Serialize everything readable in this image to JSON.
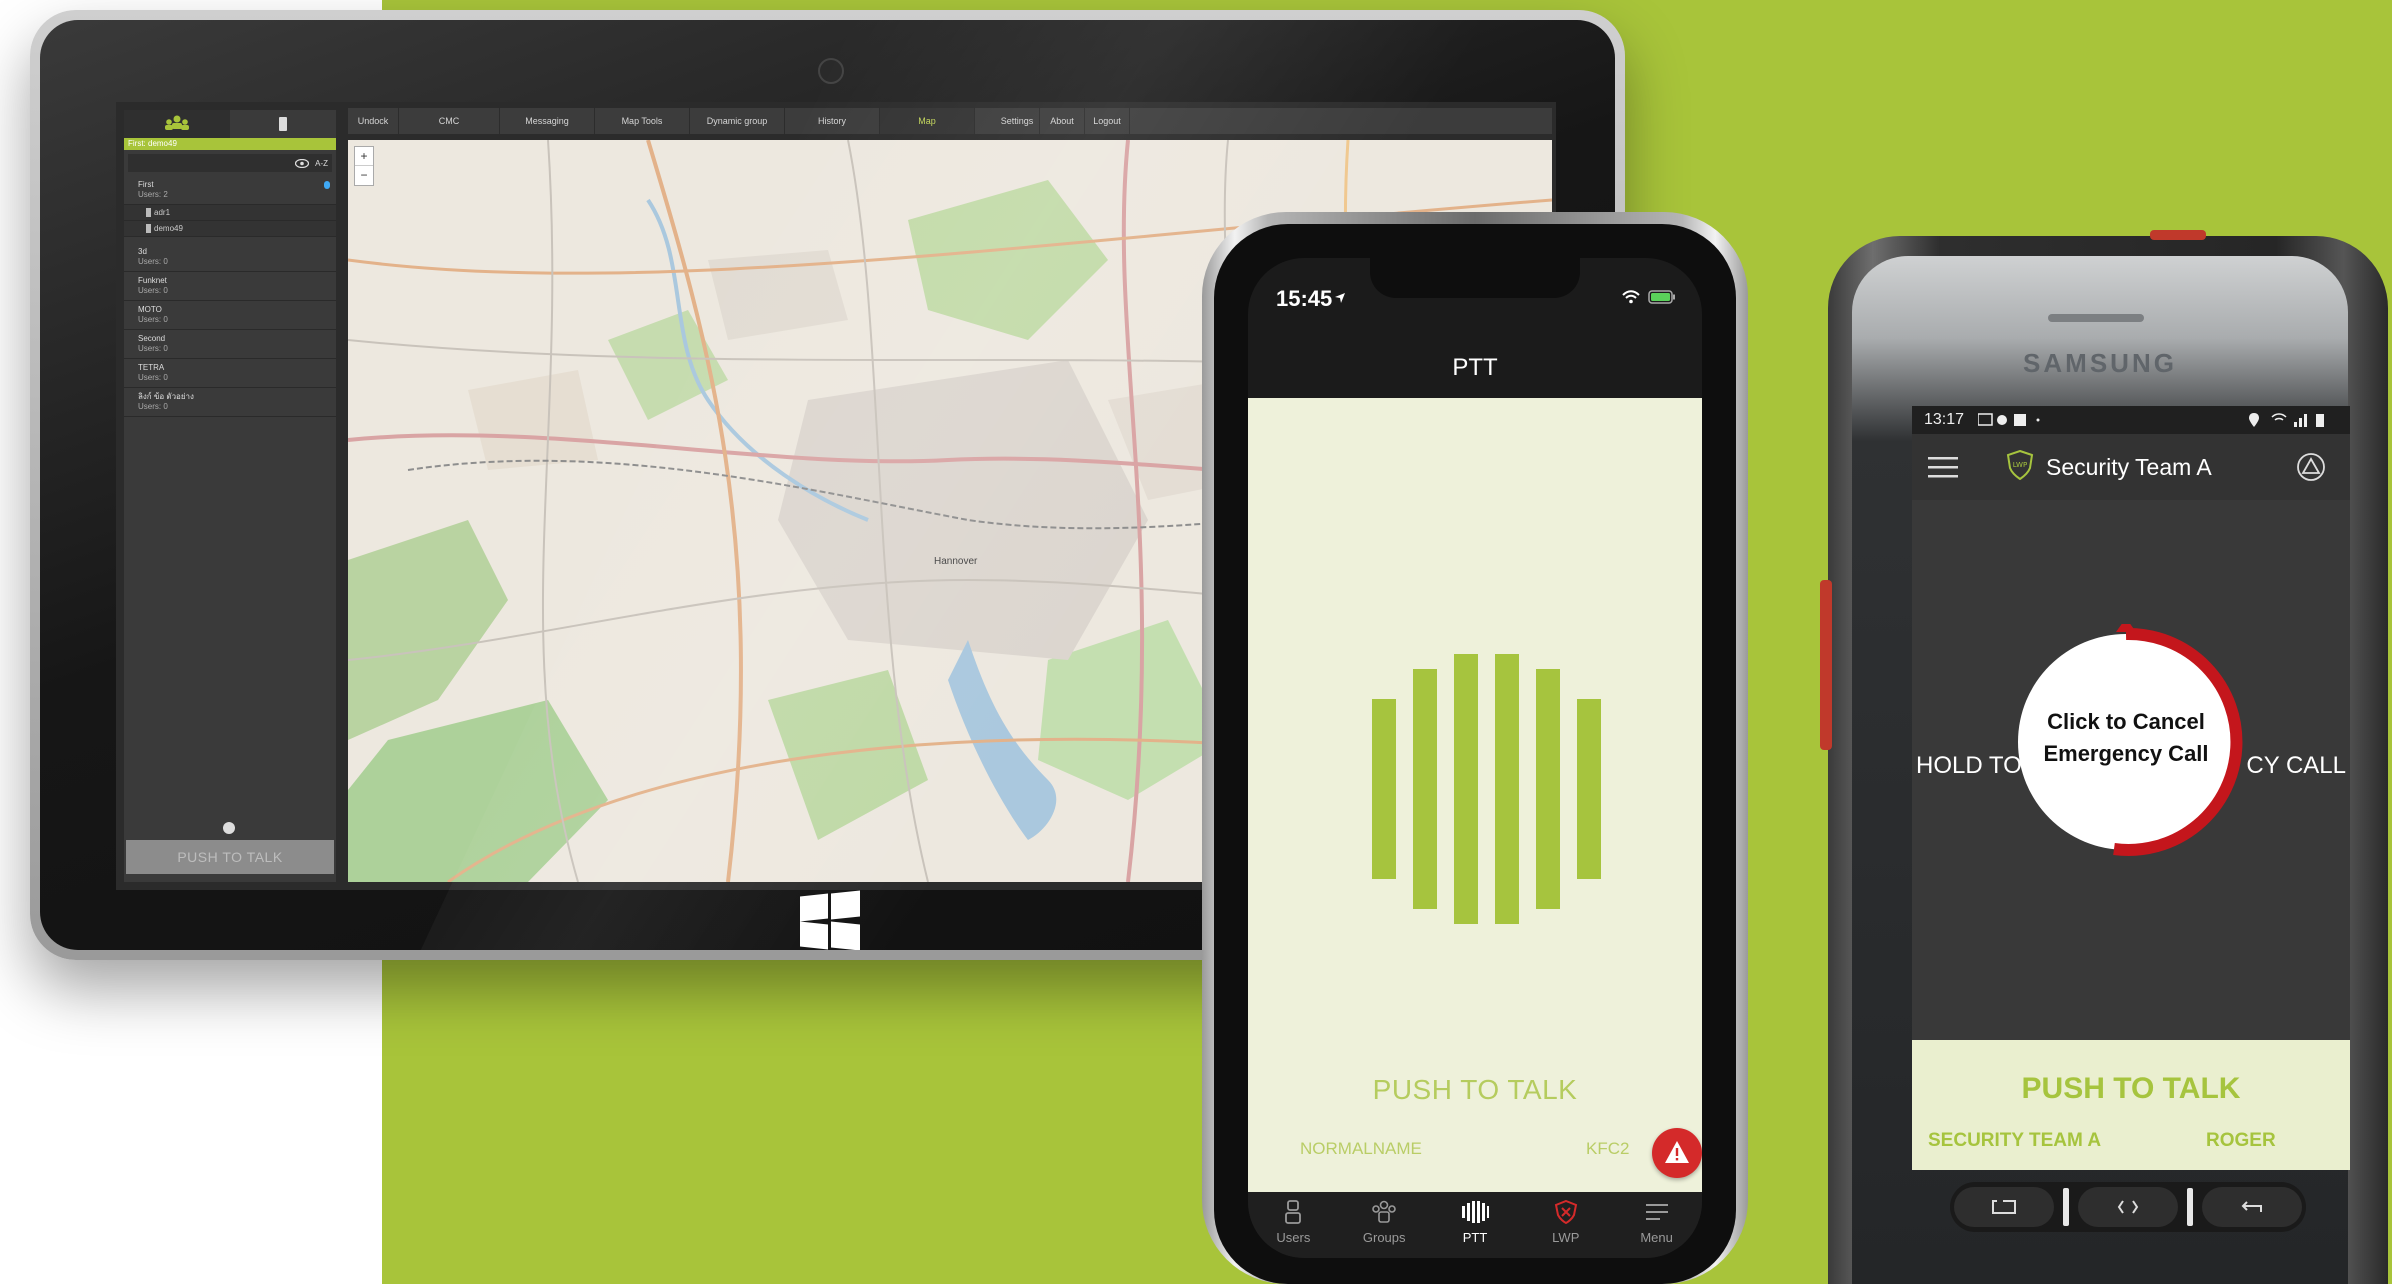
{
  "colors": {
    "background_green": "#a8c43a",
    "accent_green": "#a6c43e",
    "emergency_red": "#d42a2a",
    "panel_dark": "#3a3a3a"
  },
  "desktop": {
    "sidebar": {
      "first_bar": "First: demo49",
      "sort_label": "A-Z",
      "groups": [
        {
          "name": "First",
          "users": "Users: 2"
        },
        {
          "name": "3d",
          "users": "Users: 0"
        },
        {
          "name": "Funknet",
          "users": "Users: 0"
        },
        {
          "name": "MOTO",
          "users": "Users: 0"
        },
        {
          "name": "Second",
          "users": "Users: 0"
        },
        {
          "name": "TETRA",
          "users": "Users: 0"
        },
        {
          "name": "ลิงก์ ข้อ ตัวอย่าง",
          "users": "Users: 0"
        }
      ],
      "users": [
        "adr1",
        "demo49"
      ],
      "ptt_label": "PUSH TO TALK"
    },
    "menu": [
      "Undock",
      "CMC",
      "Messaging",
      "Map Tools",
      "Dynamic group",
      "History",
      "Map",
      "Settings",
      "About",
      "Logout"
    ],
    "active_menu": "Map",
    "zoom_in": "+",
    "zoom_out": "−",
    "map_label": "Hannover"
  },
  "iphone": {
    "time": "15:45",
    "title": "PTT",
    "ptt_label": "PUSH TO TALK",
    "name_left": "NORMALNAME",
    "name_right": "KFC2",
    "tabs": [
      {
        "label": "Users",
        "icon": "user-icon"
      },
      {
        "label": "Groups",
        "icon": "groups-icon"
      },
      {
        "label": "PTT",
        "icon": "ptt-bars-icon"
      },
      {
        "label": "LWP",
        "icon": "lwp-shield-icon"
      },
      {
        "label": "Menu",
        "icon": "menu-icon"
      }
    ],
    "active_tab": "PTT"
  },
  "samsung": {
    "brand": "SAMSUNG",
    "time": "13:17",
    "title": "Security Team A",
    "hold_left": "HOLD TO",
    "hold_right": "CY CALL",
    "cancel_line1": "Click to Cancel",
    "cancel_line2": "Emergency Call",
    "ptt_label": "PUSH TO TALK",
    "team_label": "SECURITY TEAM A",
    "roger_label": "ROGER",
    "nav_icons": [
      "recent-apps-icon",
      "home-icon",
      "back-icon"
    ]
  }
}
